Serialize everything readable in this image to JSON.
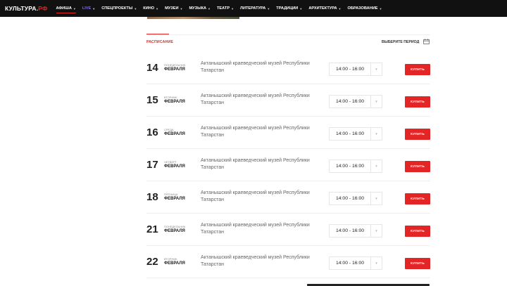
{
  "header": {
    "logo_main": "КУЛЬТУРА.",
    "logo_accent": "РФ",
    "nav": [
      {
        "label": "АФИША",
        "caret": true,
        "active": true
      },
      {
        "label": "LIVE",
        "caret": true,
        "live": true
      },
      {
        "label": "СПЕЦПРОЕКТЫ",
        "caret": true
      },
      {
        "label": "КИНО",
        "caret": true
      },
      {
        "label": "МУЗЕИ",
        "caret": true
      },
      {
        "label": "МУЗЫКА",
        "caret": true
      },
      {
        "label": "ТЕАТР",
        "caret": true
      },
      {
        "label": "ЛИТЕРАТУРА",
        "caret": true
      },
      {
        "label": "ТРАДИЦИИ",
        "caret": true
      },
      {
        "label": "АРХИТЕКТУРА",
        "caret": true
      },
      {
        "label": "ОБРАЗОВАНИЕ",
        "caret": true
      }
    ]
  },
  "schedule": {
    "tab_label": "РАСПИСАНИЕ",
    "period_label": "ВЫБЕРИТЕ ПЕРИОД",
    "calendar_icon": "calendar-icon",
    "buy_label": "КУПИТЬ",
    "rows": [
      {
        "day": "14",
        "weekday": "ПОНЕДЕЛЬНИК",
        "month": "ФЕВРАЛЯ",
        "place": "Актанышский краеведческий музей Республики Татарстан",
        "time": "14:00 - 16:00"
      },
      {
        "day": "15",
        "weekday": "ВТОРНИК",
        "month": "ФЕВРАЛЯ",
        "place": "Актанышский краеведческий музей Республики Татарстан",
        "time": "14:00 - 16:00"
      },
      {
        "day": "16",
        "weekday": "СРЕДА",
        "month": "ФЕВРАЛЯ",
        "place": "Актанышский краеведческий музей Республики Татарстан",
        "time": "14:00 - 16:00"
      },
      {
        "day": "17",
        "weekday": "ЧЕТВЕРГ",
        "month": "ФЕВРАЛЯ",
        "place": "Актанышский краеведческий музей Республики Татарстан",
        "time": "14:00 - 16:00"
      },
      {
        "day": "18",
        "weekday": "ПЯТНИЦА",
        "month": "ФЕВРАЛЯ",
        "place": "Актанышский краеведческий музей Республики Татарстан",
        "time": "14:00 - 16:00"
      },
      {
        "day": "21",
        "weekday": "ПОНЕДЕЛЬНИК",
        "month": "ФЕВРАЛЯ",
        "place": "Актанышский краеведческий музей Республики Татарстан",
        "time": "14:00 - 16:00"
      },
      {
        "day": "22",
        "weekday": "ВТОРНИК",
        "month": "ФЕВРАЛЯ",
        "place": "Актанышский краеведческий музей Республики Татарстан",
        "time": "14:00 - 16:00"
      }
    ]
  },
  "colors": {
    "accent": "#e32526",
    "header_bg": "#111111",
    "live": "#7b6cf0"
  }
}
